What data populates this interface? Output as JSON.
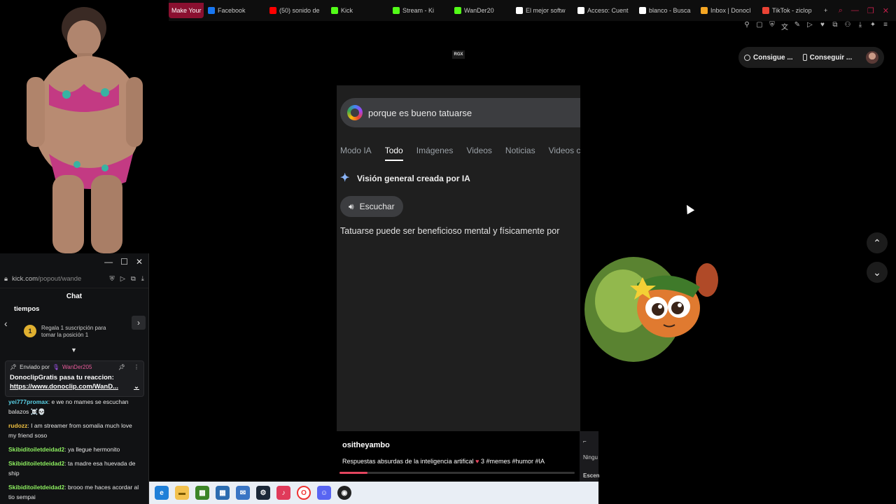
{
  "browser": {
    "tabs": [
      {
        "label": "Make Your",
        "favicon": "make-your-icon",
        "color": "#c0204a"
      },
      {
        "label": "Facebook",
        "favicon": "facebook-icon",
        "color": "#1877f2"
      },
      {
        "label": "(50) sonido de",
        "favicon": "youtube-icon",
        "color": "#ff0000"
      },
      {
        "label": "Kick",
        "favicon": "kick-icon",
        "color": "#53fc18"
      },
      {
        "label": "Stream - Ki",
        "favicon": "kick-icon",
        "color": "#53fc18"
      },
      {
        "label": "WanDer20",
        "favicon": "kick-icon",
        "color": "#53fc18"
      },
      {
        "label": "El mejor softw",
        "favicon": "diamond-icon",
        "color": "#ffffff"
      },
      {
        "label": "Acceso: Cuent",
        "favicon": "google-icon",
        "color": "#ffffff"
      },
      {
        "label": "blanco - Busca",
        "favicon": "google-icon",
        "color": "#ffffff"
      },
      {
        "label": "Inbox | Donocl",
        "favicon": "donoclip-icon",
        "color": "#f5a623"
      },
      {
        "label": "TikTok - ziclop",
        "favicon": "gmail-icon",
        "color": "#ea4335"
      }
    ],
    "new_tab": "+"
  },
  "top_right": {
    "consigue_label": "Consigue ...",
    "conseguir_label": "Conseguir ..."
  },
  "logo": "RGX",
  "video": {
    "search_query": "porque es bueno tatuarse",
    "tabs": [
      "Modo IA",
      "Todo",
      "Imágenes",
      "Videos",
      "Noticias",
      "Videos c"
    ],
    "active_tab": "Todo",
    "ai_overview": "Visión general creada por IA",
    "listen_label": "Escuchar",
    "ai_text": "Tatuarse puede ser beneficioso mental y físicamente por"
  },
  "caption": {
    "username": "ositheyambo",
    "description": "Respuestas absurdas de la inteligencia artifical",
    "tags": "3 #memes #humor #IA",
    "progress": 0.12
  },
  "chat": {
    "url_host": "kick.com",
    "url_path": "/popout/wande",
    "title": "Chat",
    "top_text": "tiempos",
    "medal_number": "1",
    "gift_text_1": "Regala 1 suscripción para",
    "gift_text_2": "tomar la posición 1",
    "pinned": {
      "sent_by": "Enviado por",
      "author": "WanDer205",
      "message": "DonoclipGratis pasa tu reaccion:",
      "link": "https://www.donoclip.com/WanD..."
    },
    "messages": [
      {
        "user": "yei777promax",
        "color": "#5ad1e6",
        "text": "e we no mames se escuchan balazos ☠️💀"
      },
      {
        "user": "rudozz",
        "color": "#f0c040",
        "text": "I am streamer from somalia much love my friend soso"
      },
      {
        "user": "Skibiditoiletdeidad2",
        "color": "#8ef060",
        "text": "ya llegue hermonito"
      },
      {
        "user": "Skibiditoiletdeidad2",
        "color": "#8ef060",
        "text": "ta madre esa huevada de ship"
      },
      {
        "user": "Skibiditoiletdeidad2",
        "color": "#8ef060",
        "text": "brooo me haces acordar al tio sempai"
      }
    ]
  },
  "obs": {
    "label_1": "Ningu",
    "label_2": "Escen"
  }
}
